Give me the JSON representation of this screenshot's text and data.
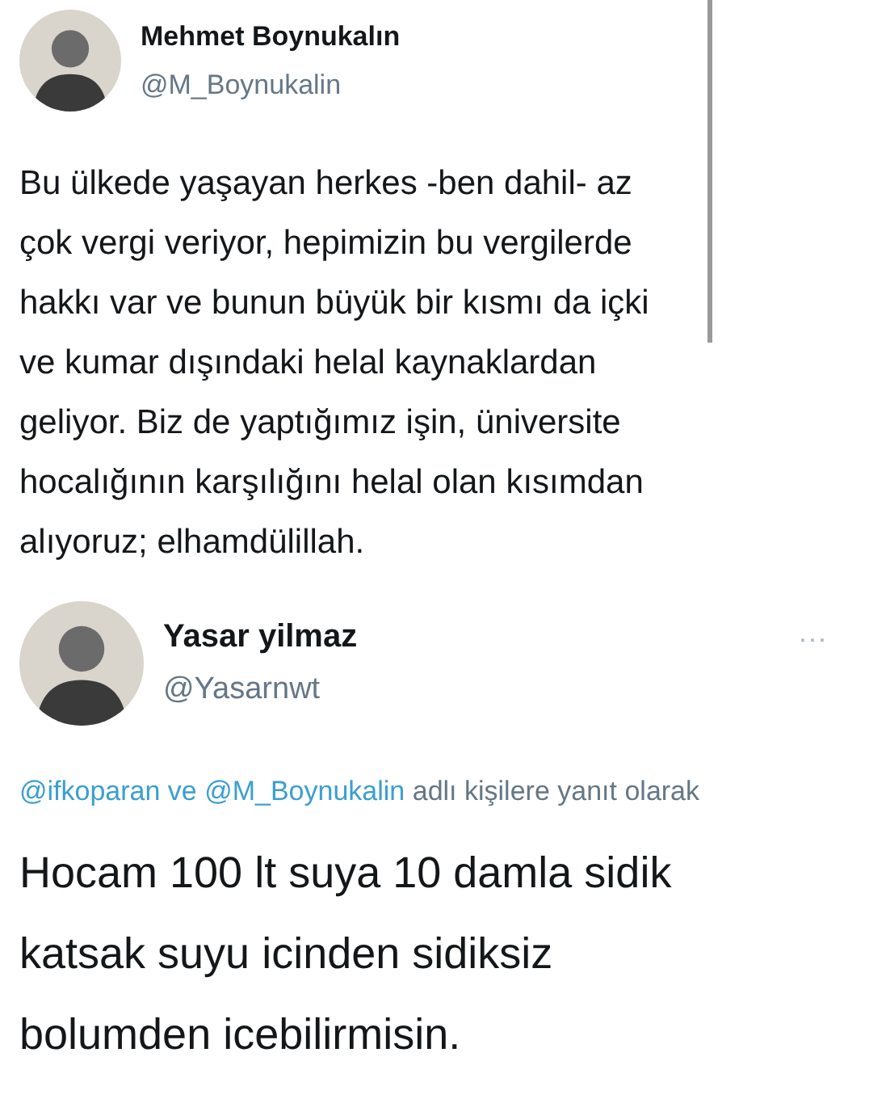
{
  "tweets": [
    {
      "name": "Mehmet Boynukalın",
      "handle": "@M_Boynukalin",
      "text": "Bu ülkede yaşayan herkes -ben dahil- az çok vergi veriyor, hepimizin bu vergilerde hakkı var ve bunun büyük bir kısmı da içki ve kumar dışındaki helal kaynaklardan geliyor. Biz de yaptığımız işin, üniversite hocalığının karşılığını helal olan kısımdan alıyoruz; elhamdülillah."
    },
    {
      "name": "Yasar yilmaz",
      "handle": "@Yasarnwt",
      "more": "···",
      "reply_to": "@ifkoparan ve @M_Boynukalin",
      "reply_suffix": "adlı kişilere yanıt olarak",
      "text": "Hocam 100 lt suya 10 damla sidik katsak suyu icinden sidiksiz bolumden icebilirmisin."
    }
  ]
}
